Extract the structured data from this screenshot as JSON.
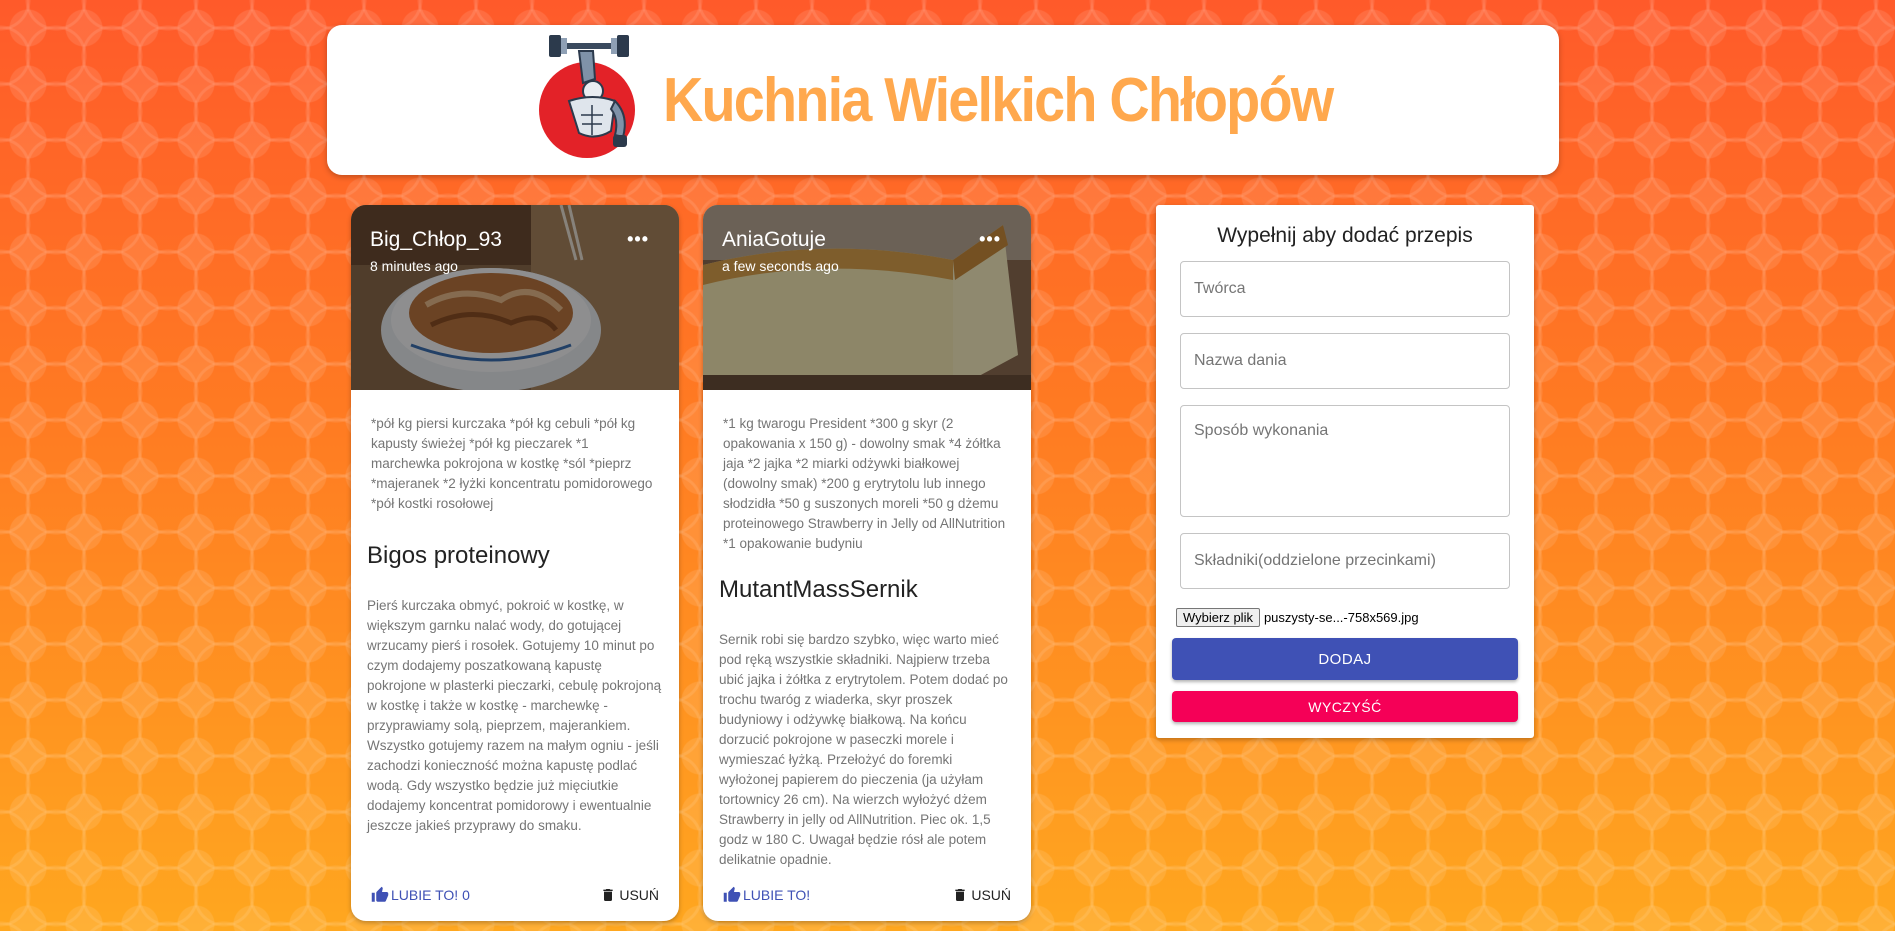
{
  "app": {
    "title": "Kuchnia Wielkich Chłopów",
    "logo_icon": "bodybuilder-dumbbell-logo-icon"
  },
  "posts": [
    {
      "creator": "Big_Chłop_93",
      "created": "8 minutes ago",
      "more_label": "•••",
      "tags": "*pół kg piersi kurczaka *pół kg cebuli *pół kg kapusty świeżej *pół kg pieczarek *1 marchewka pokrojona w kostkę *sól *pieprz *majeranek *2 łyżki koncentratu pomidorowego *pół kostki rosołowej",
      "title": "Bigos proteinowy",
      "message": "Pierś kurczaka obmyć, pokroić w kostkę, w większym garnku nalać wody, do gotującej wrzucamy pierś i rosołek. Gotujemy 10 minut po czym dodajemy poszatkowaną kapustę pokrojone w plasterki pieczarki, cebulę pokrojoną w kostkę i także w kostkę - marchewkę - przyprawiamy solą, pieprzem, majerankiem. Wszystko gotujemy razem na małym ogniu - jeśli zachodzi konieczność można kapustę podlać wodą. Gdy wszystko będzie już mięciutkie dodajemy koncentrat pomidorowy i ewentualnie jeszcze jakieś przyprawy do smaku.",
      "like_label": "LUBIE TO! 0",
      "delete_label": "USUŃ"
    },
    {
      "creator": "AniaGotuje",
      "created": "a few seconds ago",
      "more_label": "•••",
      "tags": "*1 kg twarogu President *300 g skyr (2 opakowania x 150 g) - dowolny smak *4 żółtka jaja *2 jajka *2 miarki odżywki białkowej (dowolny smak) *200 g erytrytolu lub innego słodzidła *50 g suszonych moreli *50 g dżemu proteinowego Strawberry in Jelly od AllNutrition *1 opakowanie budyniu",
      "title": "MutantMassSernik",
      "message": "Sernik robi się bardzo szybko, więc warto mieć pod ręką wszystkie składniki. Najpierw trzeba ubić jajka i żółtka z erytrytolem. Potem dodać po trochu twaróg z wiaderka, skyr proszek budyniowy i odżywkę białkową. Na końcu dorzucić pokrojone w paseczki morele i wymieszać łyżką. Przełożyć do foremki wyłożonej papierem do pieczenia (ja użyłam tortownicy 26 cm). Na wierzch wyłożyć dżem Strawberry in jelly od AllNutrition. Piec ok. 1,5 godz w 180 C. Uwagał będzie rósł ale potem delikatnie opadnie.",
      "like_label": "LUBIE TO!",
      "delete_label": "USUŃ"
    }
  ],
  "form": {
    "title": "Wypełnij aby dodać przepis",
    "creator_placeholder": "Twórca",
    "title_placeholder": "Nazwa dania",
    "message_placeholder": "Sposób wykonania",
    "tags_placeholder": "Składniki(oddzielone przecinkami)",
    "file_button": "Wybierz plik",
    "file_name": "puszysty-se...-758x569.jpg",
    "submit_label": "DODAJ",
    "clear_label": "WYCZYŚĆ"
  },
  "colors": {
    "title_orange": "#ffa84d",
    "primary": "#3f51b5",
    "secondary": "#f50057",
    "background_top": "#ff5a2a",
    "background_bottom": "#ffa71f"
  }
}
